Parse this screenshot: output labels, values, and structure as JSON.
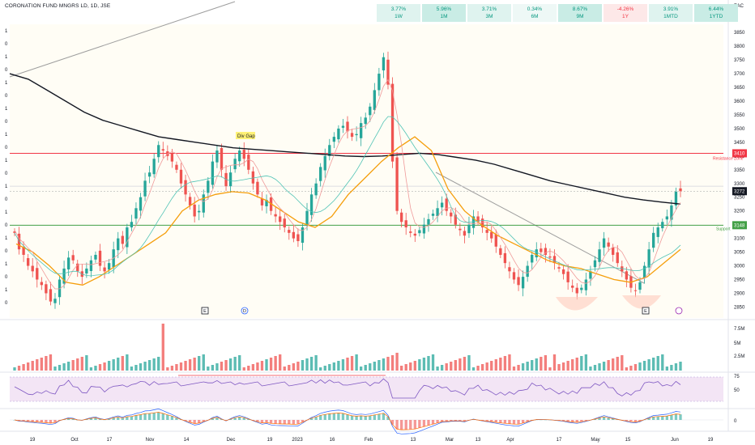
{
  "header": {
    "symbol_title": "CORONATION FUND MNGRS LD, 1D, JSE",
    "currency": "ZAC"
  },
  "performance": [
    {
      "value": "3.77%",
      "period": "1W",
      "bg": "#dff3ef",
      "color": "#089981"
    },
    {
      "value": "5.96%",
      "period": "1M",
      "bg": "#c9ece5",
      "color": "#089981"
    },
    {
      "value": "3.71%",
      "period": "3M",
      "bg": "#dff3ef",
      "color": "#089981"
    },
    {
      "value": "0.34%",
      "period": "6M",
      "bg": "#eef8f6",
      "color": "#089981"
    },
    {
      "value": "8.67%",
      "period": "9M",
      "bg": "#c9ece5",
      "color": "#089981"
    },
    {
      "value": "-4.26%",
      "period": "1Y",
      "bg": "#fde8e8",
      "color": "#f23645"
    },
    {
      "value": "3.91%",
      "period": "1MTD",
      "bg": "#dff3ef",
      "color": "#089981"
    },
    {
      "value": "6.44%",
      "period": "1YTD",
      "bg": "#c9ece5",
      "color": "#089981"
    }
  ],
  "levels": {
    "resistance_label": "Resistance Zone",
    "resistance_value": "3410",
    "support_label": "Support",
    "support_value": "3148",
    "last_price": "3272",
    "div_gap": "Div Gap"
  },
  "colors": {
    "up": "#26a69a",
    "down": "#ef5350",
    "resistance": "#f23645",
    "support": "#43a047",
    "ma_long": "#131722",
    "ma_mid": "#f59e0b",
    "ma_fast": "#ef9a9a",
    "ma_teal": "#4fc3b5",
    "rsi": "#7e57c2"
  },
  "markers": {
    "earnings": "E",
    "dividend": "D"
  },
  "chart_data": {
    "type": "candlestick",
    "price_axis": {
      "ticks": [
        2850,
        2900,
        2950,
        3000,
        3050,
        3100,
        3150,
        3200,
        3250,
        3300,
        3350,
        3400,
        3450,
        3500,
        3550,
        3600,
        3650,
        3700,
        3750,
        3800,
        3850
      ],
      "range": [
        2810,
        3880
      ]
    },
    "time_axis": [
      "19",
      "Oct",
      "17",
      "Nov",
      "14",
      "Dec",
      "19",
      "2023",
      "16",
      "Feb",
      "13",
      "Mar",
      "13",
      "Apr",
      "17",
      "May",
      "15",
      "Jun",
      "19"
    ],
    "closes": [
      3120,
      3060,
      3040,
      3000,
      2980,
      2950,
      2930,
      2900,
      2870,
      2880,
      2950,
      2990,
      3030,
      3020,
      2980,
      2960,
      2990,
      3020,
      3040,
      3000,
      2980,
      3010,
      3060,
      3100,
      3080,
      3140,
      3160,
      3210,
      3250,
      3310,
      3340,
      3390,
      3440,
      3420,
      3400,
      3380,
      3350,
      3300,
      3260,
      3220,
      3180,
      3200,
      3260,
      3310,
      3380,
      3420,
      3350,
      3290,
      3340,
      3390,
      3420,
      3390,
      3350,
      3300,
      3260,
      3220,
      3240,
      3200,
      3180,
      3160,
      3140,
      3120,
      3100,
      3090,
      3140,
      3200,
      3260,
      3300,
      3360,
      3400,
      3440,
      3470,
      3500,
      3510,
      3490,
      3470,
      3480,
      3520,
      3540,
      3580,
      3640,
      3700,
      3760,
      3660,
      3380,
      3200,
      3160,
      3140,
      3120,
      3110,
      3130,
      3150,
      3170,
      3190,
      3210,
      3230,
      3200,
      3180,
      3150,
      3130,
      3110,
      3150,
      3180,
      3160,
      3140,
      3120,
      3100,
      3070,
      3040,
      3010,
      2980,
      2950,
      2930,
      2960,
      3000,
      3040,
      3060,
      3050,
      3040,
      3030,
      3010,
      2990,
      2970,
      2940,
      2920,
      2900,
      2920,
      2950,
      2980,
      3020,
      3060,
      3100,
      3070,
      3040,
      3010,
      2980,
      2950,
      2920,
      2910,
      2940,
      3000,
      3060,
      3120,
      3140,
      3160,
      3180,
      3220,
      3270,
      3272
    ],
    "ma_long_approx": [
      3700,
      3680,
      3640,
      3600,
      3560,
      3530,
      3510,
      3490,
      3470,
      3460,
      3450,
      3440,
      3430,
      3425,
      3420,
      3415,
      3410,
      3405,
      3400,
      3398,
      3400,
      3405,
      3410,
      3405,
      3395,
      3385,
      3370,
      3350,
      3330,
      3310,
      3295,
      3280,
      3265,
      3250,
      3240,
      3232,
      3225
    ],
    "ma_mid_approx": [
      3080,
      3050,
      3000,
      2940,
      2930,
      2960,
      3000,
      3040,
      3080,
      3120,
      3200,
      3240,
      3260,
      3270,
      3265,
      3240,
      3200,
      3160,
      3140,
      3180,
      3260,
      3320,
      3380,
      3430,
      3470,
      3420,
      3280,
      3200,
      3150,
      3110,
      3080,
      3050,
      3020,
      3000,
      2990,
      2970,
      2950,
      2940,
      2960,
      3010,
      3060
    ],
    "volume_axis": [
      "7.5M",
      "5M",
      "2.5M"
    ],
    "rsi_axis": [
      "75",
      "50"
    ],
    "macd_axis": [
      "0"
    ]
  }
}
